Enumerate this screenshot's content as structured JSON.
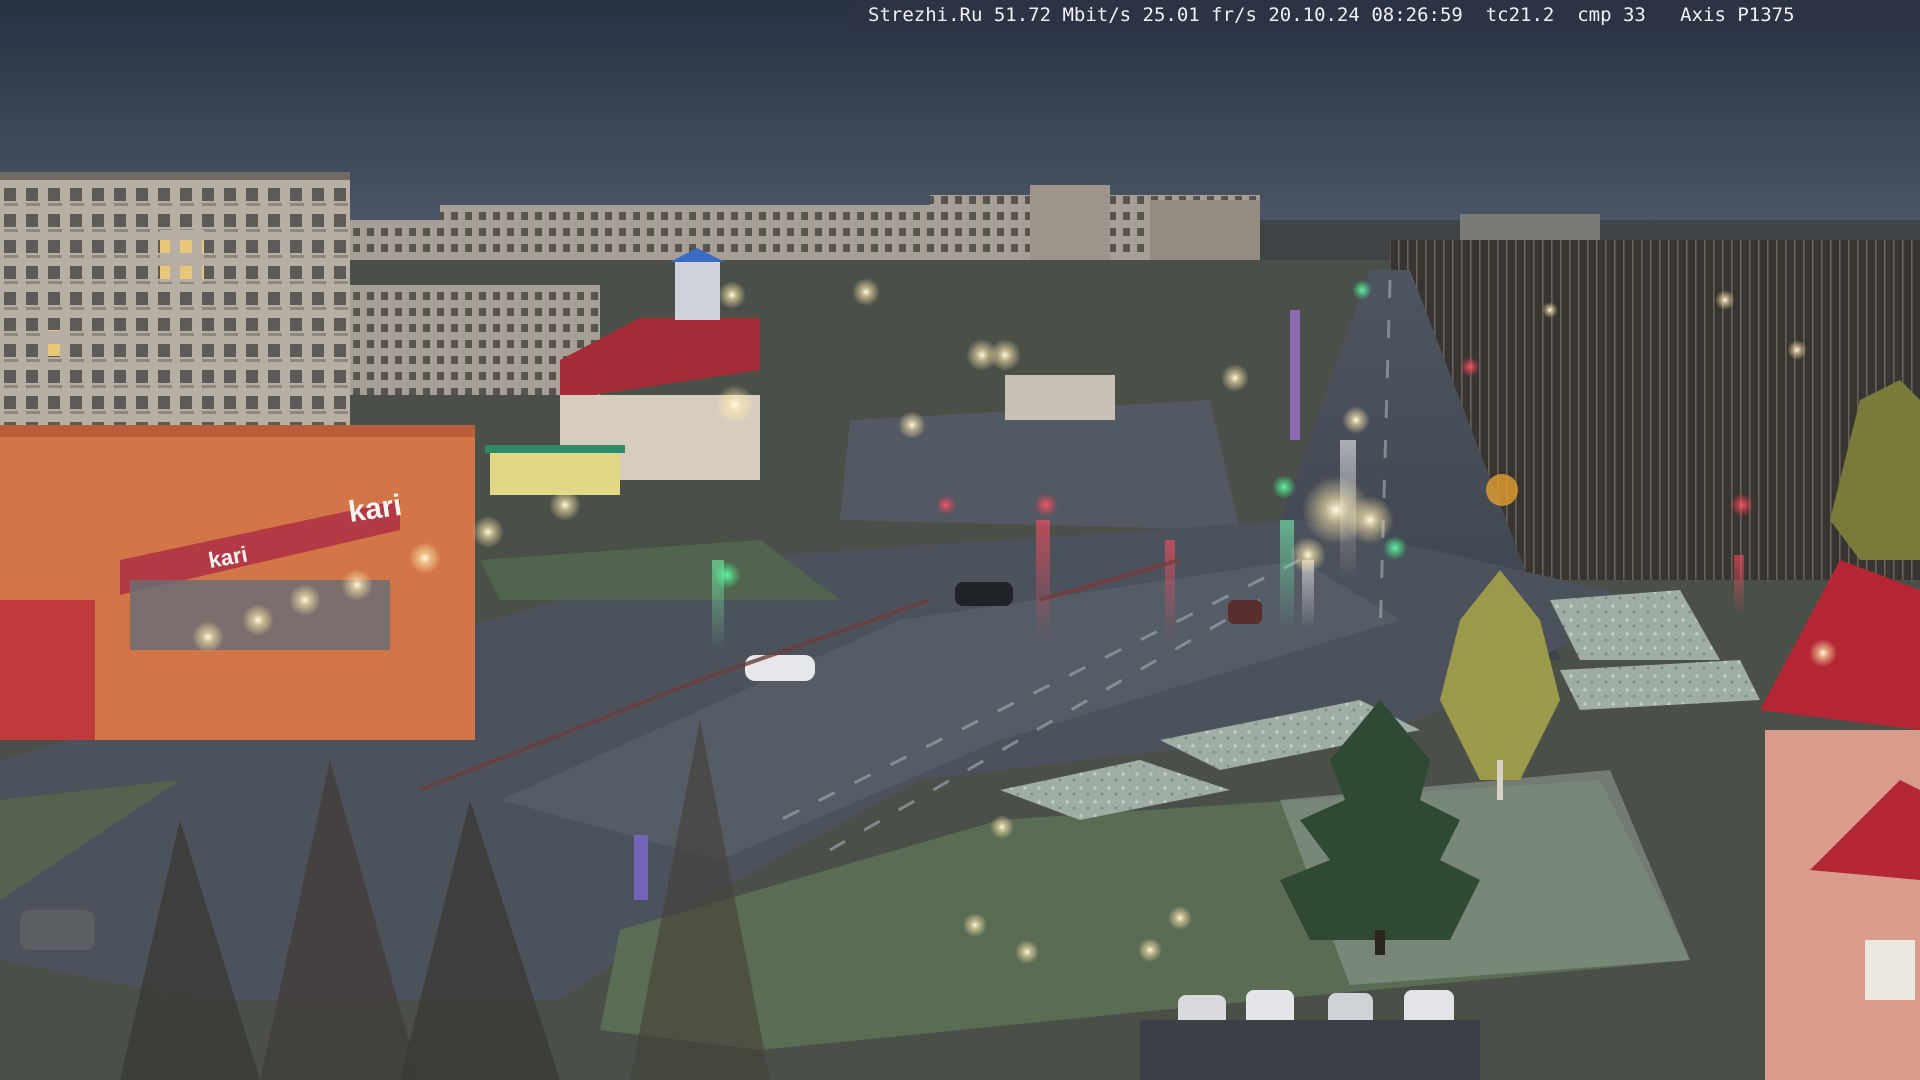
{
  "overlay": {
    "text": "Strezhi.Ru 51.72 Mbit/s 25.01 fr/s 20.10.24 08:26:59  tc21.2  cmp 33   Axis P1375"
  },
  "signs": {
    "store_name": "kari",
    "store_name_small": "kari"
  },
  "colors": {
    "sky_top": "#2b3446",
    "sky_bottom": "#4a5566",
    "road": "#474d57",
    "road_wet": "#5a616b",
    "grass": "#5d6d55",
    "frost": "#a9b5ad",
    "building_panel": "#b9b2a8",
    "store_red": "#b23a3a",
    "store_front": "#d17146",
    "roof_red": "#b52734",
    "tree_dark": "#3b3834",
    "pine": "#2f4a34",
    "light_warm": "#fff1c8",
    "signal_red": "#ff3750",
    "signal_green": "#3cff8a"
  }
}
